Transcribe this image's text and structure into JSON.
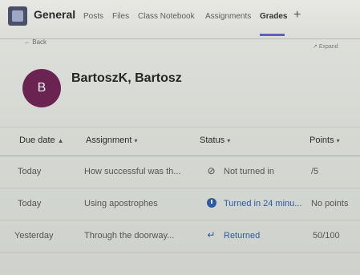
{
  "channel": {
    "name": "General"
  },
  "tabs": [
    {
      "label": "Posts"
    },
    {
      "label": "Files"
    },
    {
      "label": "Class Notebook"
    },
    {
      "label": "Assignments"
    },
    {
      "label": "Grades",
      "active": true
    }
  ],
  "add_tab_symbol": "+",
  "back_label": "Back",
  "expand_label": "Expand",
  "student": {
    "initial": "B",
    "name": "BartoszK, Bartosz"
  },
  "table": {
    "columns": [
      {
        "label": "Due date",
        "sort": "▲"
      },
      {
        "label": "Assignment",
        "sort": "▾"
      },
      {
        "label": "Status",
        "sort": "▾"
      },
      {
        "label": "Points",
        "sort": "▾"
      }
    ],
    "rows": [
      {
        "due": "Today",
        "assignment": "How successful was th...",
        "status": "Not turned in",
        "status_icon": "not-turned-in-icon",
        "points": "/5"
      },
      {
        "due": "Today",
        "assignment": "Using apostrophes",
        "status": "Turned in 24 minu...",
        "status_icon": "clock-icon",
        "points": "No points"
      },
      {
        "due": "Yesterday",
        "assignment": "Through the doorway...",
        "status": "Returned",
        "status_icon": "return-arrow-icon",
        "points": "50/100"
      }
    ]
  },
  "colors": {
    "accent": "#5b5fc7",
    "avatar": "#6b2452",
    "status_blue": "#2d5aa3"
  }
}
